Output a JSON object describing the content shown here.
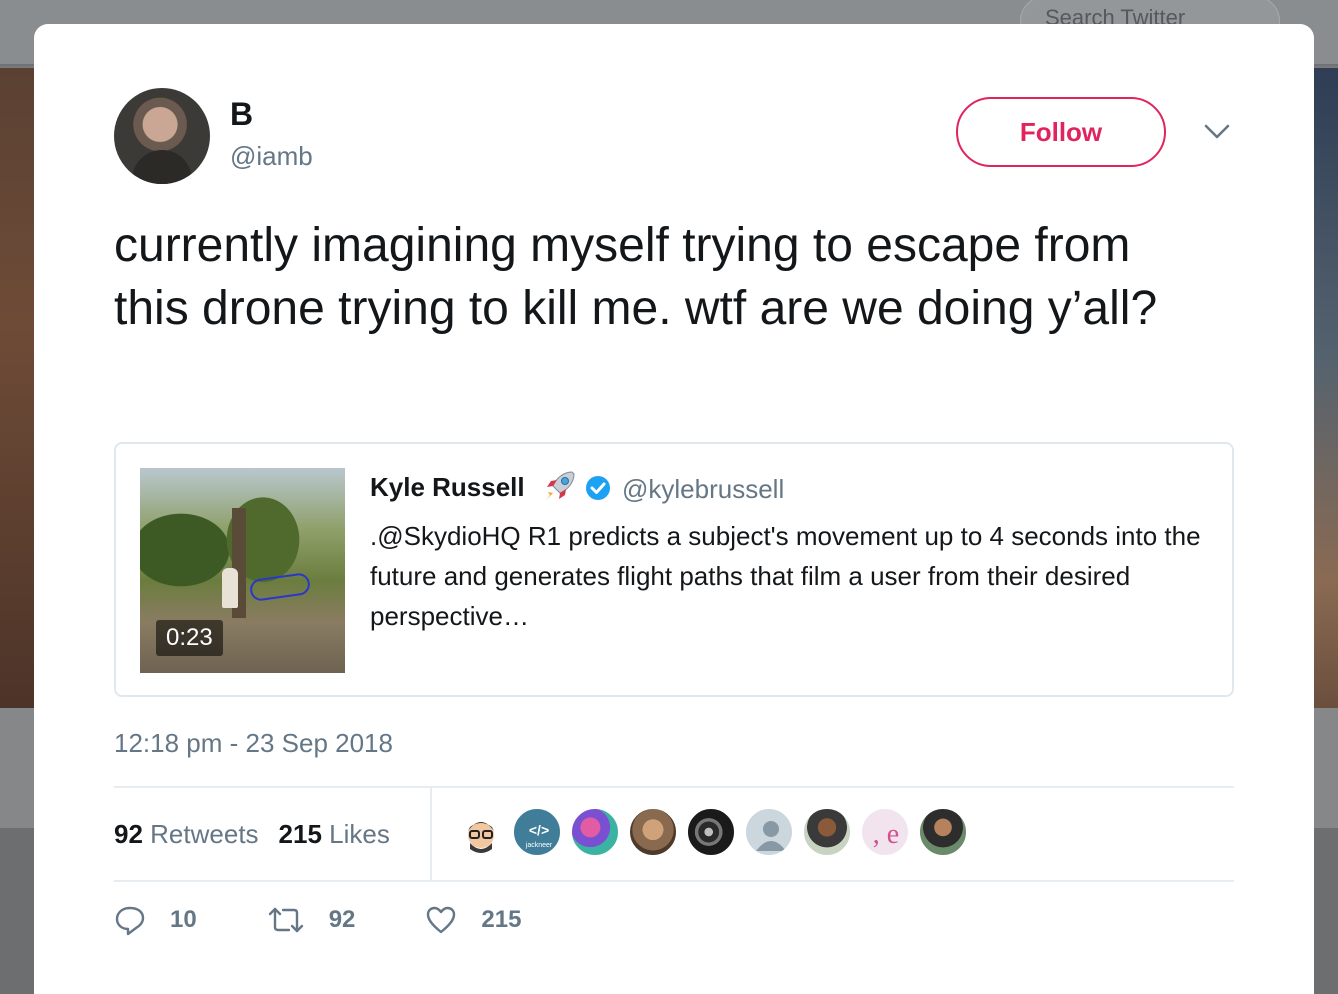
{
  "background": {
    "search_placeholder": "Search Twitter"
  },
  "tweet": {
    "author_name": "B",
    "author_handle": "@iamb",
    "follow_label": "Follow",
    "text": "currently imagining myself trying to escape from this drone trying to kill me. wtf are we doing y’all?",
    "timestamp": "12:18 pm - 23 Sep 2018",
    "retweet_count": "92",
    "retweet_label": "Retweets",
    "like_count": "215",
    "like_label": "Likes"
  },
  "quoted_tweet": {
    "author_name": "Kyle Russell",
    "author_handle": "@kylebrussell",
    "text": ".@SkydioHQ R1 predicts a subject's movement up to 4 seconds into the future and generates flight paths that film a user from their desired perspective…",
    "video_duration": "0:23"
  },
  "likers": [
    {
      "icon": "avatar-glasses-cartoon",
      "color": "#ffffff"
    },
    {
      "icon": "avatar-jackneer",
      "color": "#3f7d99",
      "text": "</>",
      "subtext": "jackneer"
    },
    {
      "icon": "avatar-colorful",
      "color": "#b15bb5"
    },
    {
      "icon": "avatar-cat",
      "color": "#8a6a4e"
    },
    {
      "icon": "avatar-dark-swirl",
      "color": "#2a2a2a"
    },
    {
      "icon": "avatar-default",
      "color": "#ccd6dd"
    },
    {
      "icon": "avatar-person",
      "color": "#3a3a3a"
    },
    {
      "icon": "avatar-letter-e",
      "color": "#f1e4ef",
      "text": ", e"
    },
    {
      "icon": "avatar-person-outdoor",
      "color": "#4a5d4a"
    }
  ],
  "actions": {
    "reply_count": "10",
    "retweet_count": "92",
    "like_count": "215"
  },
  "colors": {
    "accent_follow": "#e0245e",
    "text_primary": "#14171a",
    "text_secondary": "#657786",
    "verified_blue": "#1da1f2"
  }
}
